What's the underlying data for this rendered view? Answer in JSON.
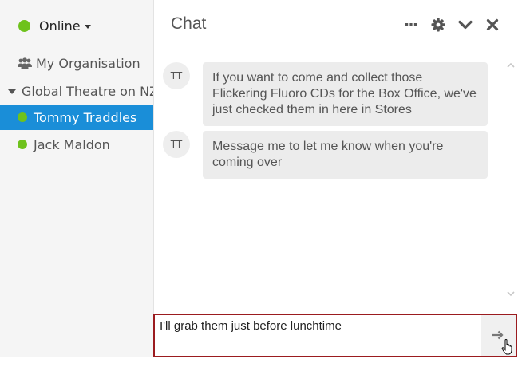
{
  "status": {
    "label": "Online",
    "color": "#6ec21c"
  },
  "sidebar": {
    "organisation": "My Organisation",
    "group": "Global Theatre on NZ H",
    "contacts": [
      {
        "name": "Tommy Traddles",
        "selected": true
      },
      {
        "name": "Jack Maldon",
        "selected": false
      }
    ]
  },
  "chat": {
    "title": "Chat",
    "icons": [
      "more-icon",
      "gear-icon",
      "chevron-down-icon",
      "close-icon"
    ]
  },
  "messages": [
    {
      "initials": "TT",
      "text": "If you want to come and collect those Flickering Fluoro CDs for the Box Office, we've just checked them in here in Stores"
    },
    {
      "initials": "TT",
      "text": "Message me to let me know when you're coming over"
    }
  ],
  "composer": {
    "value": "I'll grab them just before lunchtime"
  },
  "colors": {
    "accent": "#1a8ed8",
    "input_border": "#9b1b1f"
  }
}
